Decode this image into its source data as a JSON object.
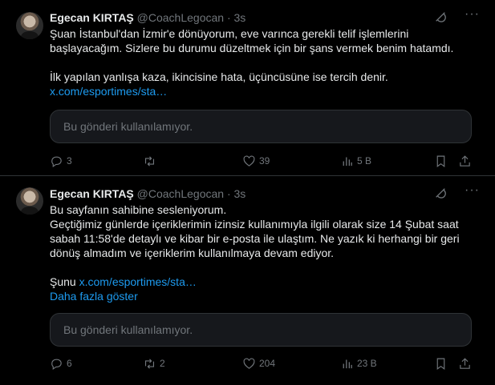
{
  "tweets": [
    {
      "author_name": "Egecan KIRTAŞ",
      "author_handle": "@CoachLegocan",
      "separator": "·",
      "time": "3s",
      "lines": [
        "Şuan İstanbul'dan İzmir'e dönüyorum, eve varınca gerekli telif işlemlerini",
        "başlayacağım. Sizlere bu durumu düzeltmek için bir şans vermek benim hatamdı.",
        "İlk yapılan yanlışa kaza, ikincisine hata, üçüncüsüne ise tercih denir."
      ],
      "link": "x.com/esportimes/sta…",
      "unavailable_text": "Bu gönderi kullanılamıyor.",
      "replies": "3",
      "retweets": "",
      "likes": "39",
      "views": "5 B"
    },
    {
      "author_name": "Egecan KIRTAŞ",
      "author_handle": "@CoachLegocan",
      "separator": "·",
      "time": "3s",
      "lines": [
        "Bu sayfanın sahibine sesleniyorum.",
        "Geçtiğimiz günlerde içeriklerimin izinsiz kullanımıyla ilgili olarak size 14 Şubat saat",
        "sabah 11:58'de detaylı ve kibar bir e-posta ile ulaştım. Ne yazık ki herhangi bir geri",
        "dönüş almadım ve içeriklerim kullanılmaya devam ediyor."
      ],
      "share_prefix": "Şunu",
      "link": "x.com/esportimes/sta…",
      "show_more": "Daha fazla göster",
      "unavailable_text": "Bu gönderi kullanılamıyor.",
      "replies": "6",
      "retweets": "2",
      "likes": "204",
      "views": "23 B"
    }
  ],
  "icons": {
    "reply": "reply-icon",
    "retweet": "retweet-icon",
    "like": "heart-icon",
    "views": "views-icon",
    "bookmark": "bookmark-icon",
    "share": "share-icon",
    "grok": "grok-icon",
    "more": "more-icon"
  },
  "colors": {
    "background": "#000000",
    "text": "#e7e9ea",
    "muted": "#71767b",
    "link": "#1d9bf0",
    "border": "#2f3336",
    "card": "#16181c"
  }
}
